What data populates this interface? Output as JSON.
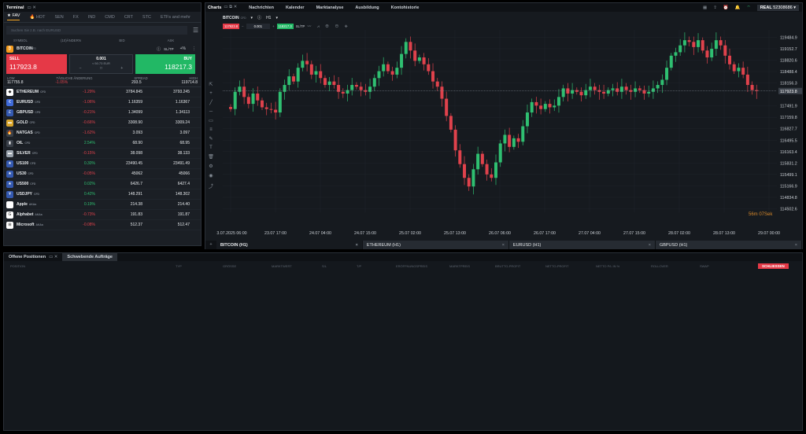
{
  "terminal": {
    "title": "Terminal",
    "tabs": [
      "FAV",
      "HOT",
      "SEN",
      "FX",
      "IND",
      "CMD",
      "CRT",
      "STC",
      "ETFs and mehr"
    ],
    "search_placeholder": "Suchen Sie z.B. nach EURUSD",
    "cols": [
      "SYMBOL",
      "(10)ÄNDERN",
      "BID",
      "ASK"
    ],
    "featured": {
      "symbol": "BITCOIN",
      "tag": "CFD",
      "sltp": "SL/TP",
      "sell_label": "SELL",
      "sell_price": "117923.8",
      "buy_label": "BUY",
      "buy_price": "118217.3",
      "volume": "0.001",
      "margin": "≈ 50.73 EUR",
      "low_label": "LOW",
      "low": "117755.8",
      "daily_label": "TÄGLICHE ÄNDERUNG",
      "daily": "-1.05%",
      "spread_label": "SPREAD",
      "spread": "293.5",
      "high_label": "HIGH",
      "high": "119714.8"
    },
    "rows": [
      {
        "symbol": "ETHEREUM",
        "tag": "CFD",
        "chg": "-1.29%",
        "bid": "3784.845",
        "ask": "3793.245",
        "color": "#ffffff",
        "glyph": "◆",
        "up": false
      },
      {
        "symbol": "EURUSD",
        "tag": "CFD",
        "chg": "-1.06%",
        "bid": "1.16359",
        "ask": "1.16367",
        "color": "#3f6ad8",
        "glyph": "€",
        "up": false
      },
      {
        "symbol": "GBPUSD",
        "tag": "CFD",
        "chg": "-0.21%",
        "bid": "1.34099",
        "ask": "1.34113",
        "color": "#3459b0",
        "glyph": "£",
        "up": false
      },
      {
        "symbol": "GOLD",
        "tag": "CFD",
        "chg": "-0.66%",
        "bid": "3308.90",
        "ask": "3309.24",
        "color": "#d9a52b",
        "glyph": "▬",
        "up": false
      },
      {
        "symbol": "NATGAS",
        "tag": "CFD",
        "chg": "-1.62%",
        "bid": "3.093",
        "ask": "3.097",
        "color": "#3a4049",
        "glyph": "🔥",
        "up": false
      },
      {
        "symbol": "OIL",
        "tag": "CFD",
        "chg": "2.54%",
        "bid": "68.90",
        "ask": "68.95",
        "color": "#3a4049",
        "glyph": "▮",
        "up": true
      },
      {
        "symbol": "SILVER",
        "tag": "CFD",
        "chg": "-0.15%",
        "bid": "38.098",
        "ask": "38.133",
        "color": "#9aa3ad",
        "glyph": "▬",
        "up": false
      },
      {
        "symbol": "US100",
        "tag": "CFD",
        "chg": "0.30%",
        "bid": "23490.45",
        "ask": "23491.49",
        "color": "#3459b0",
        "glyph": "★",
        "up": true
      },
      {
        "symbol": "US30",
        "tag": "CFD",
        "chg": "-0.05%",
        "bid": "45062",
        "ask": "45066",
        "color": "#3459b0",
        "glyph": "★",
        "up": false
      },
      {
        "symbol": "US500",
        "tag": "CFD",
        "chg": "0.02%",
        "bid": "6426.7",
        "ask": "6427.4",
        "color": "#3459b0",
        "glyph": "★",
        "up": true
      },
      {
        "symbol": "USDJPY",
        "tag": "CFD",
        "chg": "0.42%",
        "bid": "148.291",
        "ask": "148.302",
        "color": "#3459b0",
        "glyph": "¥",
        "up": true
      },
      {
        "symbol": "Apple",
        "tag": "AKAa",
        "chg": "0.19%",
        "bid": "214.38",
        "ask": "214.40",
        "color": "#ffffff",
        "glyph": "",
        "up": true
      },
      {
        "symbol": "Alphabet",
        "tag": "AKAa",
        "chg": "-0.73%",
        "bid": "191.83",
        "ask": "191.87",
        "color": "#ffffff",
        "glyph": "G",
        "up": false
      },
      {
        "symbol": "Microsoft",
        "tag": "AKAa",
        "chg": "-0.08%",
        "bid": "512.37",
        "ask": "512.47",
        "color": "#ffffff",
        "glyph": "⊞",
        "up": false
      }
    ]
  },
  "charts": {
    "title": "Charts",
    "nav": [
      "Nachrichten",
      "Kalender",
      "Marktanalyse",
      "Ausbildung",
      "Kontohistorie"
    ],
    "account": {
      "label": "REAL",
      "number": "52308686"
    },
    "symbol": "BITCOIN",
    "symbol_tag": "CFD",
    "tf": "H1",
    "mini_sell": "117923.8",
    "mini_vol": "0.001",
    "mini_buy": "118217.3",
    "mini_sltp": "SL/TP",
    "current_price": "117923.8",
    "countdown": "56m 07Sek",
    "bottom_tabs": [
      "BITCOIN (H1)",
      "ETHEREUM (H1)",
      "EURUSD (H1)",
      "GBPUSD (H1)"
    ]
  },
  "chart_data": {
    "type": "candlestick",
    "y_ticks": [
      "119484.9",
      "119152.7",
      "118820.6",
      "118488.4",
      "118156.3",
      "117491.9",
      "117159.8",
      "116827.7",
      "116495.5",
      "116163.4",
      "115831.2",
      "115499.1",
      "115166.9",
      "114834.8",
      "114502.6"
    ],
    "x_ticks": [
      "23.07.2025 06:00",
      "23.07 17:00",
      "24.07 04:00",
      "24.07 15:00",
      "25.07 02:00",
      "25.07 13:00",
      "26.07 06:00",
      "26.07 17:00",
      "27.07 04:00",
      "27.07 15:00",
      "28.07 02:00",
      "28.07 13:00",
      "29.07 00:00"
    ],
    "ylim": [
      114400,
      119700
    ],
    "closes": [
      117400,
      117900,
      118050,
      117750,
      117550,
      117850,
      117650,
      117450,
      117400,
      117380,
      117300,
      117900,
      118100,
      118350,
      118200,
      118600,
      118800,
      118700,
      118400,
      118500,
      118300,
      118100,
      118200,
      118100,
      117900,
      117850,
      117950,
      118100,
      118050,
      117950,
      117900,
      118050,
      118300,
      118500,
      118700,
      118500,
      118400,
      118600,
      119000,
      119350,
      119100,
      118800,
      118900,
      118700,
      118500,
      118200,
      118050,
      117700,
      117200,
      116800,
      116200,
      115800,
      115400,
      115150,
      115650,
      116100,
      115800,
      115500,
      115400,
      115850,
      116400,
      116650,
      116300,
      116550,
      116450,
      116900,
      117300,
      117600,
      117500,
      117400,
      117550,
      117450,
      117500,
      117750,
      118000,
      117850,
      117950,
      117900,
      117800,
      117950,
      118050,
      117950,
      117900,
      117850,
      117950,
      118000,
      117900,
      118050,
      117950,
      117900,
      118000,
      117950,
      117850,
      117900,
      118000,
      118100,
      118250,
      118600,
      118950,
      119050,
      119250,
      119400,
      119350,
      119200,
      119400,
      119100,
      118900,
      119150,
      119400,
      119250,
      118950,
      118700,
      118500,
      118600,
      118400,
      118100,
      117950,
      117923.8
    ]
  },
  "bottom": {
    "tabs": [
      "Offene Positionen",
      "Schwebende Aufträge"
    ],
    "cols": [
      "POSITION",
      "TYP",
      "GRÖSSE",
      "MARKTWERT",
      "S/L",
      "T/P",
      "ERÖFFNUNGSPREIS",
      "MARKTPREIS",
      "BRUTTO-PROFIT",
      "NETTO-PROFIT",
      "NETTO P/L IN %",
      "ROLLOVER",
      "SWAP"
    ],
    "close_all": "SCHLIESSEN"
  }
}
